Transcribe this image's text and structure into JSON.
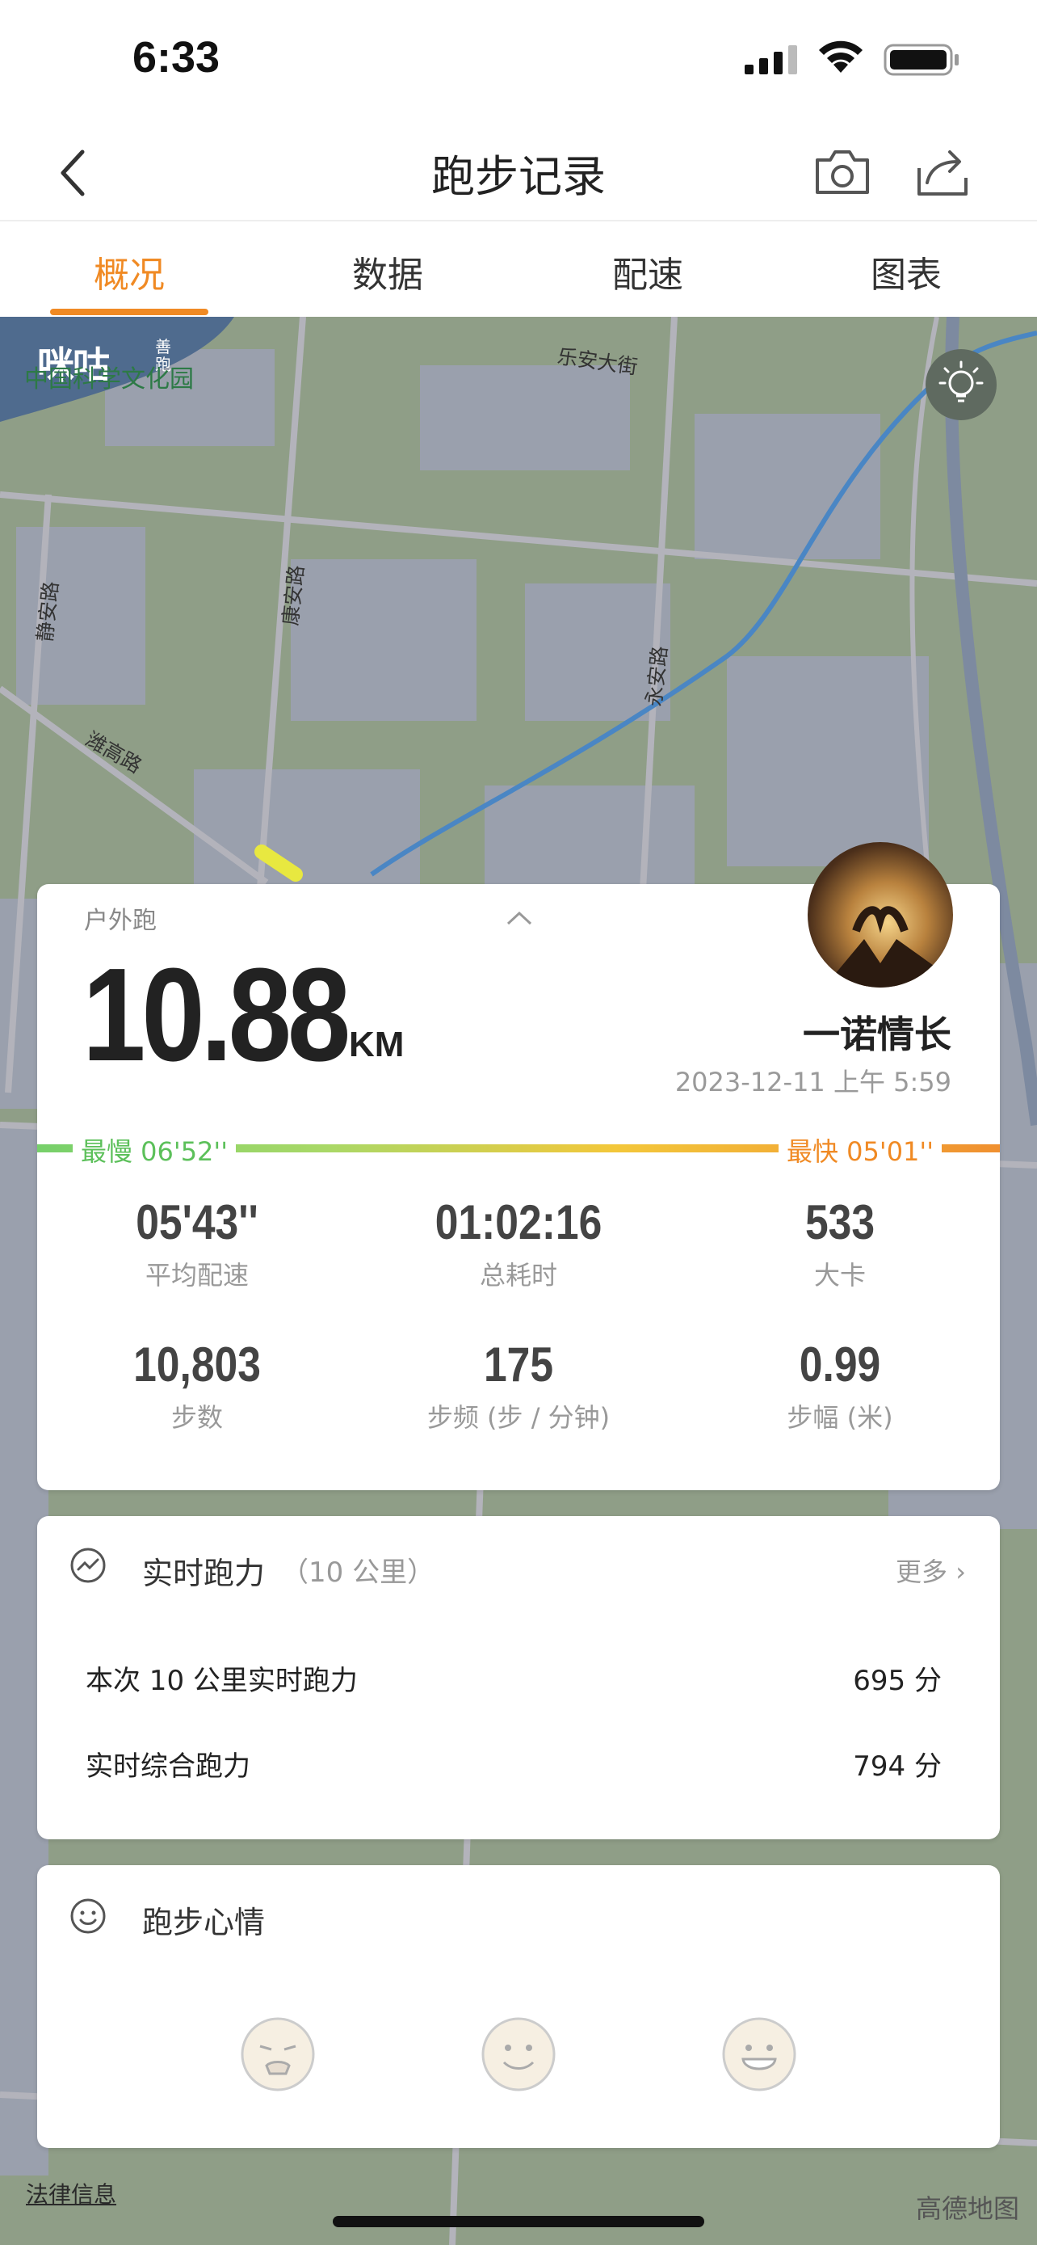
{
  "status_bar": {
    "time": "6:33"
  },
  "nav": {
    "title": "跑步记录"
  },
  "tabs": [
    {
      "label": "概况",
      "active": true
    },
    {
      "label": "数据",
      "active": false
    },
    {
      "label": "配速",
      "active": false
    },
    {
      "label": "图表",
      "active": false
    }
  ],
  "map": {
    "logo": "咪咕",
    "logo_sub": "善跑",
    "poi": "中国科学文化园",
    "streets": [
      "乐安大街",
      "康安路",
      "静安路",
      "潍高路",
      "永安路"
    ],
    "legal": "法律信息",
    "credit": "高德地图"
  },
  "summary": {
    "run_type": "户外跑",
    "distance": "10.88",
    "distance_unit": "KM",
    "username": "一诺情长",
    "datetime": "2023-12-11 上午 5:59",
    "slowest_label": "最慢  06'52''",
    "fastest_label": "最快  05'01''",
    "stats": [
      {
        "value": "05'43''",
        "label": "平均配速"
      },
      {
        "value": "01:02:16",
        "label": "总耗时"
      },
      {
        "value": "533",
        "label": "大卡"
      },
      {
        "value": "10,803",
        "label": "步数"
      },
      {
        "value": "175",
        "label": "步频 (步 / 分钟)"
      },
      {
        "value": "0.99",
        "label": "步幅 (米)"
      }
    ]
  },
  "power": {
    "title": "实时跑力",
    "subtitle": "（10 公里）",
    "more": "更多 ›",
    "rows": [
      {
        "label": "本次 10 公里实时跑力",
        "value": "695 分"
      },
      {
        "label": "实时综合跑力",
        "value": "794 分"
      }
    ]
  },
  "mood": {
    "title": "跑步心情"
  },
  "colors": {
    "accent": "#f08a24",
    "slow": "#5cc05a"
  }
}
